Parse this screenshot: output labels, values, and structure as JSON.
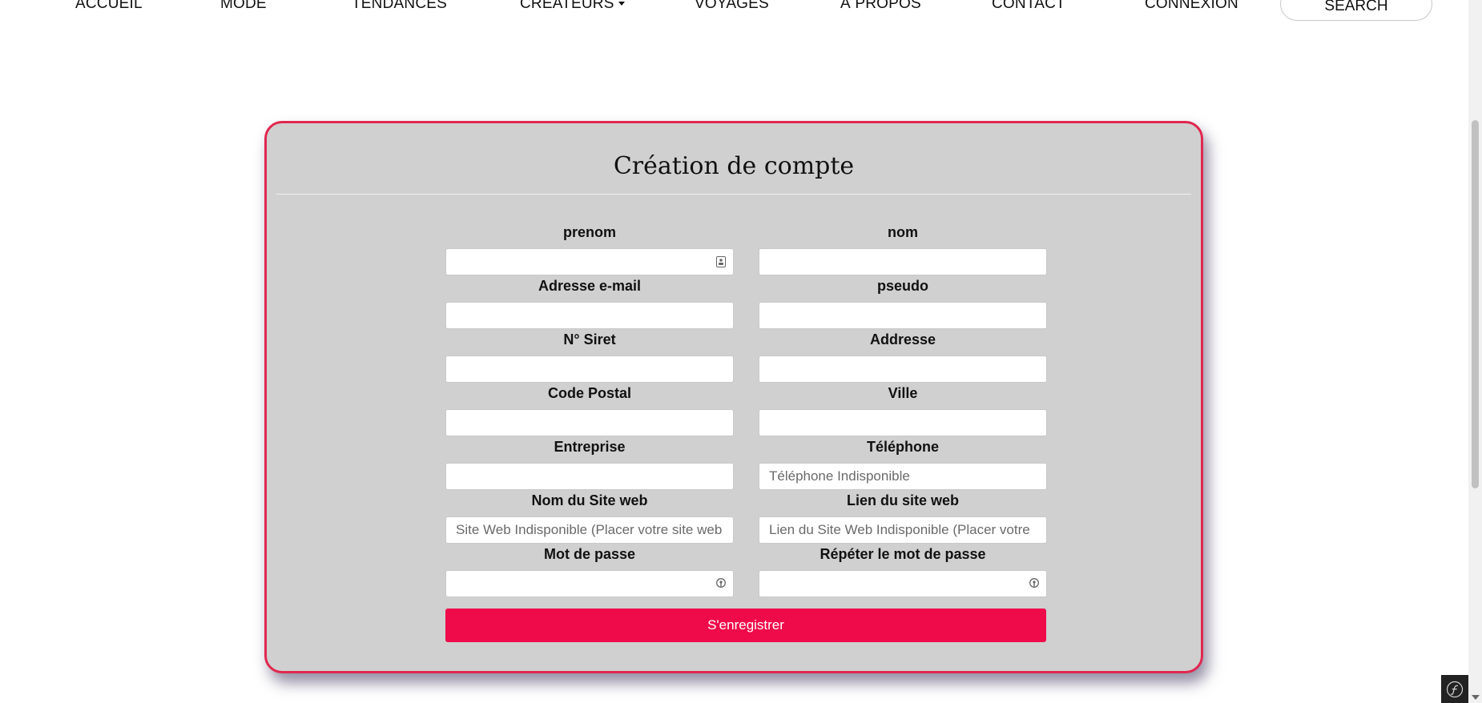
{
  "nav": {
    "items": [
      {
        "label": "ACCUEIL"
      },
      {
        "label": "MODE"
      },
      {
        "label": "TENDANCES"
      },
      {
        "label": "CRÉATEURS"
      },
      {
        "label": "VOYAGES"
      },
      {
        "label": "À PROPOS"
      },
      {
        "label": "CONTACT"
      },
      {
        "label": "CONNEXION"
      }
    ],
    "search_label": "SEARCH"
  },
  "form": {
    "title": "Création de compte",
    "fields": {
      "prenom": {
        "label": "prenom",
        "value": "",
        "placeholder": ""
      },
      "nom": {
        "label": "nom",
        "value": "",
        "placeholder": ""
      },
      "email": {
        "label": "Adresse e-mail",
        "value": "",
        "placeholder": ""
      },
      "pseudo": {
        "label": "pseudo",
        "value": "",
        "placeholder": ""
      },
      "siret": {
        "label": "N° Siret",
        "value": "",
        "placeholder": ""
      },
      "addresse": {
        "label": "Addresse",
        "value": "",
        "placeholder": ""
      },
      "code_postal": {
        "label": "Code Postal",
        "value": "",
        "placeholder": ""
      },
      "ville": {
        "label": "Ville",
        "value": "",
        "placeholder": ""
      },
      "entreprise": {
        "label": "Entreprise",
        "value": "",
        "placeholder": ""
      },
      "telephone": {
        "label": "Téléphone",
        "value": "",
        "placeholder": "Téléphone Indisponible"
      },
      "site_nom": {
        "label": "Nom du Site web",
        "value": "",
        "placeholder": "Site Web Indisponible (Placer votre site web"
      },
      "site_lien": {
        "label": "Lien du site web",
        "value": "",
        "placeholder": "Lien du Site Web Indisponible (Placer votre"
      },
      "mot_de_passe": {
        "label": "Mot de passe",
        "value": "",
        "placeholder": ""
      },
      "mot_de_passe_repeat": {
        "label": "Répéter le mot de passe",
        "value": "",
        "placeholder": ""
      }
    },
    "submit_label": "S'enregistrer"
  },
  "colors": {
    "accent": "#ef0a4a",
    "card_border": "#e0284f",
    "card_bg": "#d0d0d0"
  },
  "icons": {
    "contact_card": "address-card-icon",
    "password_key": "key-icon",
    "symfony": "symfony-logo-icon"
  }
}
